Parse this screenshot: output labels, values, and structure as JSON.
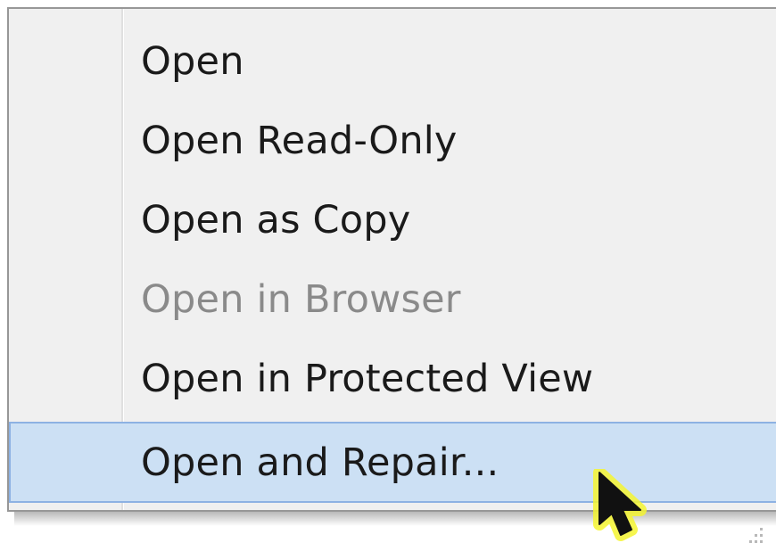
{
  "context_menu": {
    "items": [
      {
        "label": "Open",
        "state": "normal"
      },
      {
        "label": "Open Read-Only",
        "state": "normal"
      },
      {
        "label": "Open as Copy",
        "state": "normal"
      },
      {
        "label": "Open in Browser",
        "state": "disabled"
      },
      {
        "label": "Open in Protected View",
        "state": "normal"
      },
      {
        "label": "Open and Repair...",
        "state": "highlighted"
      }
    ]
  },
  "cursor": {
    "icon": "arrow-cursor-icon",
    "highlight_color": "#f4f430"
  },
  "colors": {
    "menu_background": "#f0f0f0",
    "highlight_background": "#cce0f4",
    "highlight_border": "#8db2e3",
    "text": "#1a1a1a",
    "disabled_text": "#8a8a8a"
  }
}
